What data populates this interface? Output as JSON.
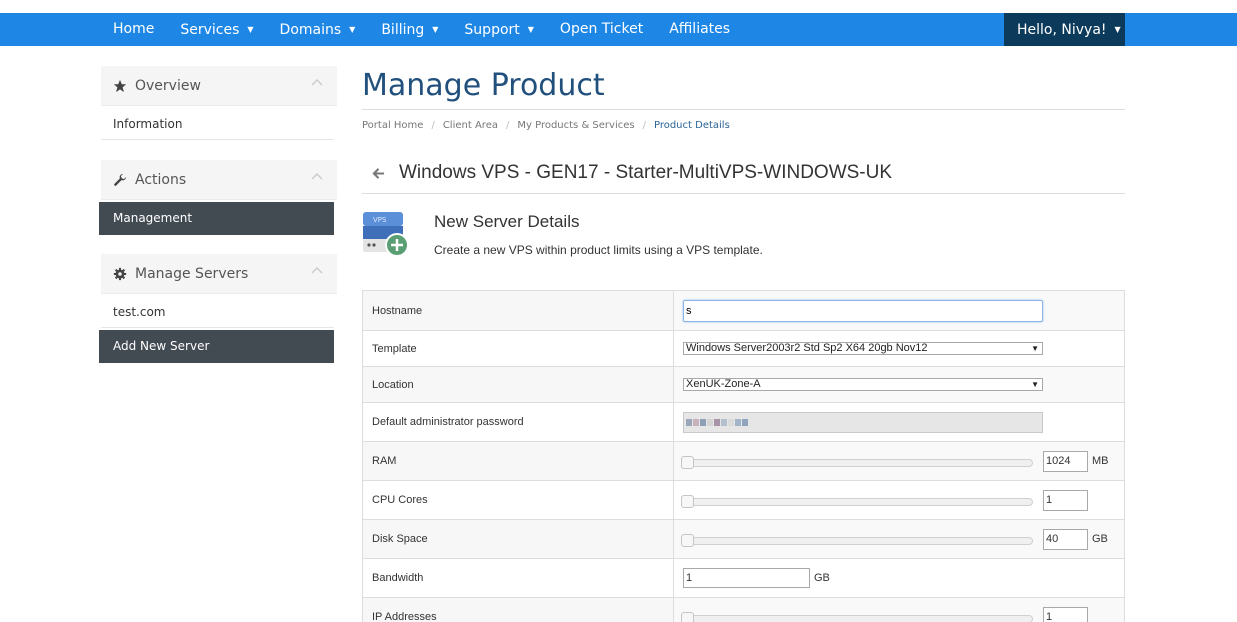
{
  "nav": {
    "items": [
      {
        "label": "Home",
        "caret": false
      },
      {
        "label": "Services",
        "caret": true
      },
      {
        "label": "Domains",
        "caret": true
      },
      {
        "label": "Billing",
        "caret": true
      },
      {
        "label": "Support",
        "caret": true
      },
      {
        "label": "Open Ticket",
        "caret": false
      },
      {
        "label": "Affiliates",
        "caret": false
      }
    ],
    "user": "Hello, Nivya!"
  },
  "sidebar": {
    "overview": {
      "title": "Overview",
      "icon": "star-icon",
      "items": [
        "Information"
      ]
    },
    "actions": {
      "title": "Actions",
      "icon": "wrench-icon",
      "items": [
        "Management"
      ]
    },
    "manage_servers": {
      "title": "Manage Servers",
      "icon": "gear-icon",
      "items": [
        "test.com",
        "Add New Server"
      ]
    }
  },
  "page": {
    "title": "Manage Product",
    "breadcrumb": [
      "Portal Home",
      "Client Area",
      "My Products & Services",
      "Product Details"
    ],
    "product_title": "Windows VPS - GEN17 - Starter-MultiVPS-WINDOWS-UK"
  },
  "section": {
    "icon_text": "VPS",
    "title": "New Server Details",
    "description": "Create a new VPS within product limits using a VPS template."
  },
  "form": {
    "hostname": {
      "label": "Hostname",
      "value": "s"
    },
    "template": {
      "label": "Template",
      "value": "Windows Server2003r2 Std Sp2 X64 20gb Nov12"
    },
    "location": {
      "label": "Location",
      "value": "XenUK-Zone-A"
    },
    "password": {
      "label": "Default administrator password"
    },
    "ram": {
      "label": "RAM",
      "value": "1024",
      "unit": "MB"
    },
    "cpu": {
      "label": "CPU Cores",
      "value": "1"
    },
    "disk": {
      "label": "Disk Space",
      "value": "40",
      "unit": "GB"
    },
    "bandwidth": {
      "label": "Bandwidth",
      "value": "1",
      "unit": "GB"
    },
    "ip": {
      "label": "IP Addresses",
      "value": "1"
    }
  },
  "colors": {
    "nav_bg": "#1e87e6",
    "user_bg": "#0b3a5b",
    "title": "#22507d",
    "active_item": "#424a52"
  }
}
